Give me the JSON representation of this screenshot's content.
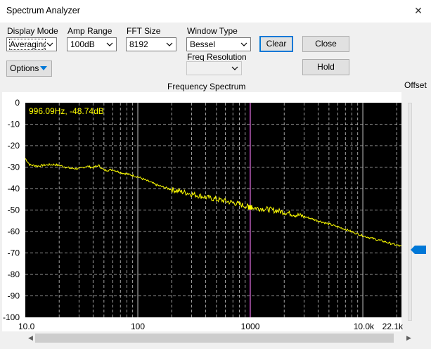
{
  "window": {
    "title": "Spectrum Analyzer",
    "close_glyph": "✕"
  },
  "controls": {
    "display_mode": {
      "label": "Display Mode",
      "value": "Averaging"
    },
    "amp_range": {
      "label": "Amp Range",
      "value": "100dB"
    },
    "fft_size": {
      "label": "FFT Size",
      "value": "8192"
    },
    "window_type": {
      "label": "Window Type",
      "value": "Bessel"
    },
    "freq_resolution": {
      "label": "Freq Resolution",
      "value": ""
    },
    "options_label": "Options",
    "clear_label": "Clear",
    "close_label": "Close",
    "hold_label": "Hold"
  },
  "chart_title": "Frequency Spectrum",
  "offset_label": "Offset",
  "offset_level": 0.68,
  "readout": "996.09Hz,  -48.74dB",
  "colors": {
    "plot_bg": "#000000",
    "trace": "#ffff00",
    "cursor": "#ff40ff",
    "grid": "#c8c8c8",
    "accent": "#0078d7"
  },
  "chart_data": {
    "type": "line",
    "title": "Frequency Spectrum",
    "x_scale": "log",
    "xlim": [
      10,
      22050
    ],
    "ylim": [
      -100,
      0
    ],
    "grid": true,
    "y_ticks": [
      "0",
      "-10",
      "-20",
      "-30",
      "-40",
      "-50",
      "-60",
      "-70",
      "-80",
      "-90",
      "-100"
    ],
    "x_ticks": [
      "10.0",
      "100",
      "1000",
      "10.0k",
      "22.1k"
    ],
    "x_tick_values": [
      10,
      100,
      1000,
      10000,
      22050
    ],
    "cursor": {
      "x": 996.09,
      "y": -48.74
    },
    "series": [
      {
        "x": [
          10,
          11,
          13,
          15,
          18,
          20,
          25,
          30,
          35,
          40,
          45,
          50,
          60,
          70,
          80,
          100,
          150,
          200,
          300,
          400,
          500,
          700,
          996,
          1500,
          2000,
          3000,
          5000,
          7000,
          10000,
          15000,
          22050
        ],
        "y": [
          -26,
          -29,
          -29.5,
          -29,
          -28.8,
          -29.2,
          -30.5,
          -30.8,
          -29.6,
          -30.2,
          -29.2,
          -31.5,
          -31.2,
          -32.5,
          -33.2,
          -34.5,
          -38.5,
          -40.5,
          -42.5,
          -44,
          -45,
          -46.5,
          -48.74,
          -49.8,
          -51,
          -53,
          -56.5,
          -59,
          -62,
          -64.5,
          -67
        ]
      }
    ]
  }
}
